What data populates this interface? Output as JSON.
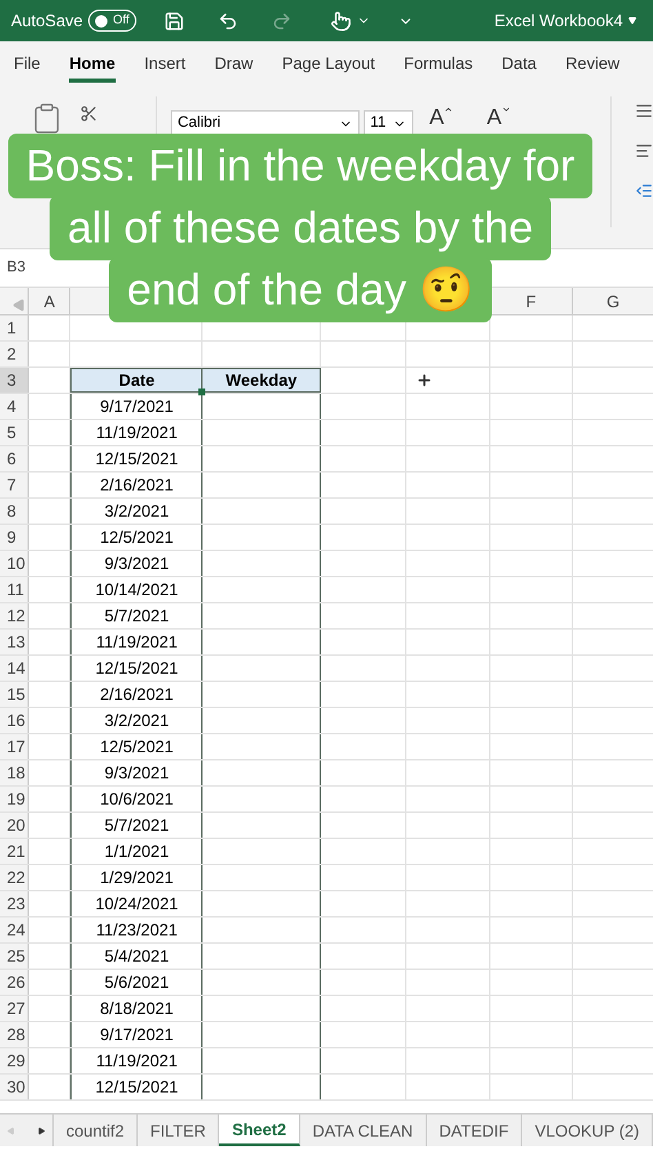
{
  "title_bar": {
    "autosave_label": "AutoSave",
    "autosave_toggle": {
      "label": "Off",
      "on": false
    },
    "redo_disabled": true,
    "workbook_title": "Excel Workbook4"
  },
  "ribbon_tabs": [
    {
      "label": "File",
      "selected": false
    },
    {
      "label": "Home",
      "selected": true
    },
    {
      "label": "Insert",
      "selected": false
    },
    {
      "label": "Draw",
      "selected": false
    },
    {
      "label": "Page Layout",
      "selected": false
    },
    {
      "label": "Formulas",
      "selected": false
    },
    {
      "label": "Data",
      "selected": false
    },
    {
      "label": "Review",
      "selected": false
    }
  ],
  "ribbon": {
    "font_name": "Calibri",
    "font_size": "11",
    "grow_font": "A",
    "shrink_font": "A"
  },
  "name_box": "B3",
  "column_headers": [
    "A",
    "F",
    "G"
  ],
  "rows": [
    {
      "number": "1",
      "kind": "empty",
      "selected": false
    },
    {
      "number": "2",
      "kind": "empty",
      "selected": false
    },
    {
      "number": "3",
      "kind": "header",
      "selected": true,
      "cells": [
        "Date",
        "Weekday"
      ]
    },
    {
      "number": "4",
      "kind": "data",
      "selected": false,
      "cells": [
        "9/17/2021"
      ]
    },
    {
      "number": "5",
      "kind": "data",
      "selected": false,
      "cells": [
        "11/19/2021"
      ]
    },
    {
      "number": "6",
      "kind": "data",
      "selected": false,
      "cells": [
        "12/15/2021"
      ]
    },
    {
      "number": "7",
      "kind": "data",
      "selected": false,
      "cells": [
        "2/16/2021"
      ]
    },
    {
      "number": "8",
      "kind": "data",
      "selected": false,
      "cells": [
        "3/2/2021"
      ]
    },
    {
      "number": "9",
      "kind": "data",
      "selected": false,
      "cells": [
        "12/5/2021"
      ]
    },
    {
      "number": "10",
      "kind": "data",
      "selected": false,
      "cells": [
        "9/3/2021"
      ]
    },
    {
      "number": "11",
      "kind": "data",
      "selected": false,
      "cells": [
        "10/14/2021"
      ]
    },
    {
      "number": "12",
      "kind": "data",
      "selected": false,
      "cells": [
        "5/7/2021"
      ]
    },
    {
      "number": "13",
      "kind": "data",
      "selected": false,
      "cells": [
        "11/19/2021"
      ]
    },
    {
      "number": "14",
      "kind": "data",
      "selected": false,
      "cells": [
        "12/15/2021"
      ]
    },
    {
      "number": "15",
      "kind": "data",
      "selected": false,
      "cells": [
        "2/16/2021"
      ]
    },
    {
      "number": "16",
      "kind": "data",
      "selected": false,
      "cells": [
        "3/2/2021"
      ]
    },
    {
      "number": "17",
      "kind": "data",
      "selected": false,
      "cells": [
        "12/5/2021"
      ]
    },
    {
      "number": "18",
      "kind": "data",
      "selected": false,
      "cells": [
        "9/3/2021"
      ]
    },
    {
      "number": "19",
      "kind": "data",
      "selected": false,
      "cells": [
        "10/6/2021"
      ]
    },
    {
      "number": "20",
      "kind": "data",
      "selected": false,
      "cells": [
        "5/7/2021"
      ]
    },
    {
      "number": "21",
      "kind": "data",
      "selected": false,
      "cells": [
        "1/1/2021"
      ]
    },
    {
      "number": "22",
      "kind": "data",
      "selected": false,
      "cells": [
        "1/29/2021"
      ]
    },
    {
      "number": "23",
      "kind": "data",
      "selected": false,
      "cells": [
        "10/24/2021"
      ]
    },
    {
      "number": "24",
      "kind": "data",
      "selected": false,
      "cells": [
        "11/23/2021"
      ]
    },
    {
      "number": "25",
      "kind": "data",
      "selected": false,
      "cells": [
        "5/4/2021"
      ]
    },
    {
      "number": "26",
      "kind": "data",
      "selected": false,
      "cells": [
        "5/6/2021"
      ]
    },
    {
      "number": "27",
      "kind": "data",
      "selected": false,
      "cells": [
        "8/18/2021"
      ]
    },
    {
      "number": "28",
      "kind": "data",
      "selected": false,
      "cells": [
        "9/17/2021"
      ]
    },
    {
      "number": "29",
      "kind": "data",
      "selected": false,
      "cells": [
        "11/19/2021"
      ]
    },
    {
      "number": "30",
      "kind": "data",
      "selected": false,
      "cells": [
        "12/15/2021"
      ]
    }
  ],
  "sheet_tabs": [
    {
      "label": "countif2",
      "selected": false
    },
    {
      "label": "FILTER",
      "selected": false
    },
    {
      "label": "Sheet2",
      "selected": true
    },
    {
      "label": "DATA CLEAN",
      "selected": false
    },
    {
      "label": "DATEDIF",
      "selected": false
    },
    {
      "label": "VLOOKUP (2)",
      "selected": false
    }
  ],
  "caption_lines": [
    "Boss: Fill in the weekday for",
    "all of these dates by the",
    "end of the day 🤨"
  ]
}
